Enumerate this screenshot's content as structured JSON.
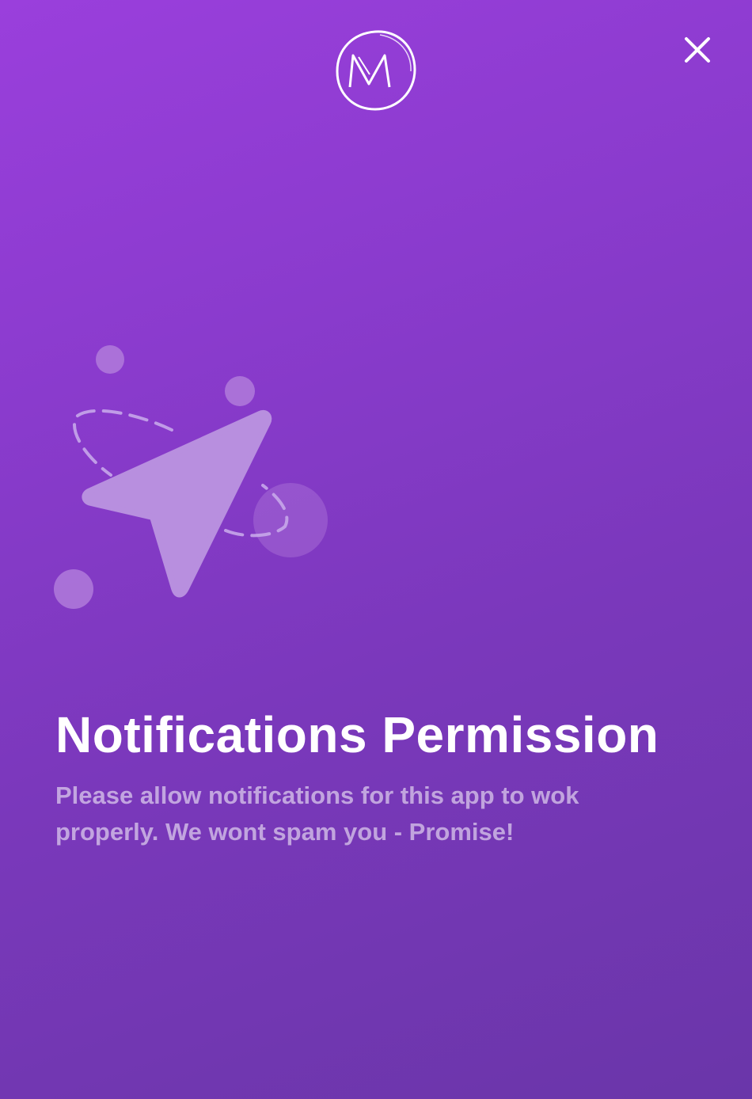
{
  "header": {
    "logo": {
      "icon": "monogram-m-logo-icon",
      "letter": "M"
    },
    "close": {
      "icon": "close-icon",
      "symbol": "×"
    }
  },
  "illustration": {
    "icon": "paper-plane-icon",
    "colors": {
      "plane": "#b88fdf",
      "dots": "#b07bdb",
      "orbit": "#c7a7ea"
    }
  },
  "content": {
    "title": "Notifications Permission",
    "description": "Please allow notifications for this app to wok properly. We wont spam you - Promise!"
  },
  "colors": {
    "background_top": "#9a3fdc",
    "background_bottom": "#6a36a9",
    "text": "#ffffff"
  }
}
